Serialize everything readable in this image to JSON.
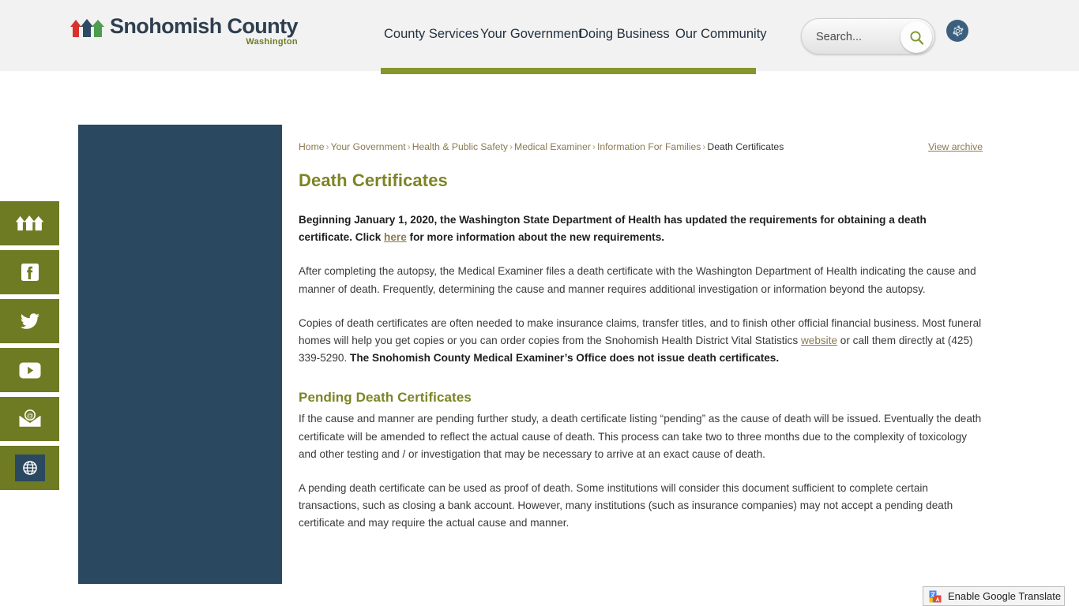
{
  "header": {
    "logo": {
      "title": "Snohomish County",
      "subtitle": "Washington",
      "icon": "mountains-logo-icon"
    },
    "nav": [
      {
        "label": "County Services"
      },
      {
        "label": "Your Government"
      },
      {
        "label": "Doing Business"
      },
      {
        "label": "Our Community"
      }
    ],
    "search": {
      "placeholder": "Search...",
      "value": "",
      "icon": "search-icon"
    },
    "settings": {
      "icon": "gear-icon"
    },
    "accent_color": "#87952f"
  },
  "social": [
    {
      "name": "snohomish-logo",
      "icon": "mountains-icon"
    },
    {
      "name": "facebook",
      "icon": "facebook-icon"
    },
    {
      "name": "twitter",
      "icon": "twitter-icon"
    },
    {
      "name": "youtube",
      "icon": "youtube-icon"
    },
    {
      "name": "email",
      "icon": "envelope-at-icon"
    },
    {
      "name": "website",
      "icon": "globe-icon"
    }
  ],
  "breadcrumb": {
    "items": [
      "Home",
      "Your Government",
      "Health & Public Safety",
      "Medical Examiner",
      "Information For Families"
    ],
    "current": "Death Certificates",
    "separator": "›"
  },
  "view_archive_label": "View archive",
  "main": {
    "title": "Death Certificates",
    "lead_part1": "Beginning January 1, 2020, the Washington State Department of Health has updated the requirements for obtaining a death certificate. Click ",
    "lead_link": "here",
    "lead_part2": " for more information about the new requirements.",
    "paragraph_2": "After completing the autopsy, the Medical Examiner files a death certificate with the Washington Department of Health indicating the cause and manner of death. Frequently, determining the cause and manner requires additional investigation or information beyond the autopsy.",
    "paragraph_3_part1": "Copies of death certificates are often needed to make insurance claims, transfer titles, and to finish other official financial business. Most funeral homes will help you get copies or you can order copies from the Snohomish Health District Vital Statistics ",
    "paragraph_3_link": "website",
    "paragraph_3_part2": " or call them directly at (425) 339-5290. ",
    "paragraph_3_bold": "The Snohomish County Medical Examiner’s Office does not issue death certificates.",
    "subhead": "Pending Death Certificates",
    "paragraph_4": "If the cause and manner are pending further study, a death certificate listing “pending” as the cause of death will be issued. Eventually the death certificate will be amended to reflect the actual cause of death. This process can take two to three months due to the complexity of toxicology and other testing and / or investigation that may be necessary to arrive at an exact cause of death.",
    "paragraph_5": "A pending death certificate can be used as proof of death. Some institutions will consider this document sufficient to complete certain transactions, such as closing a bank account. However, many institutions (such as insurance companies) may not accept a pending death certificate and may require the actual cause and manner."
  },
  "translate": {
    "label": "Enable Google Translate",
    "icon": "google-translate-icon"
  }
}
